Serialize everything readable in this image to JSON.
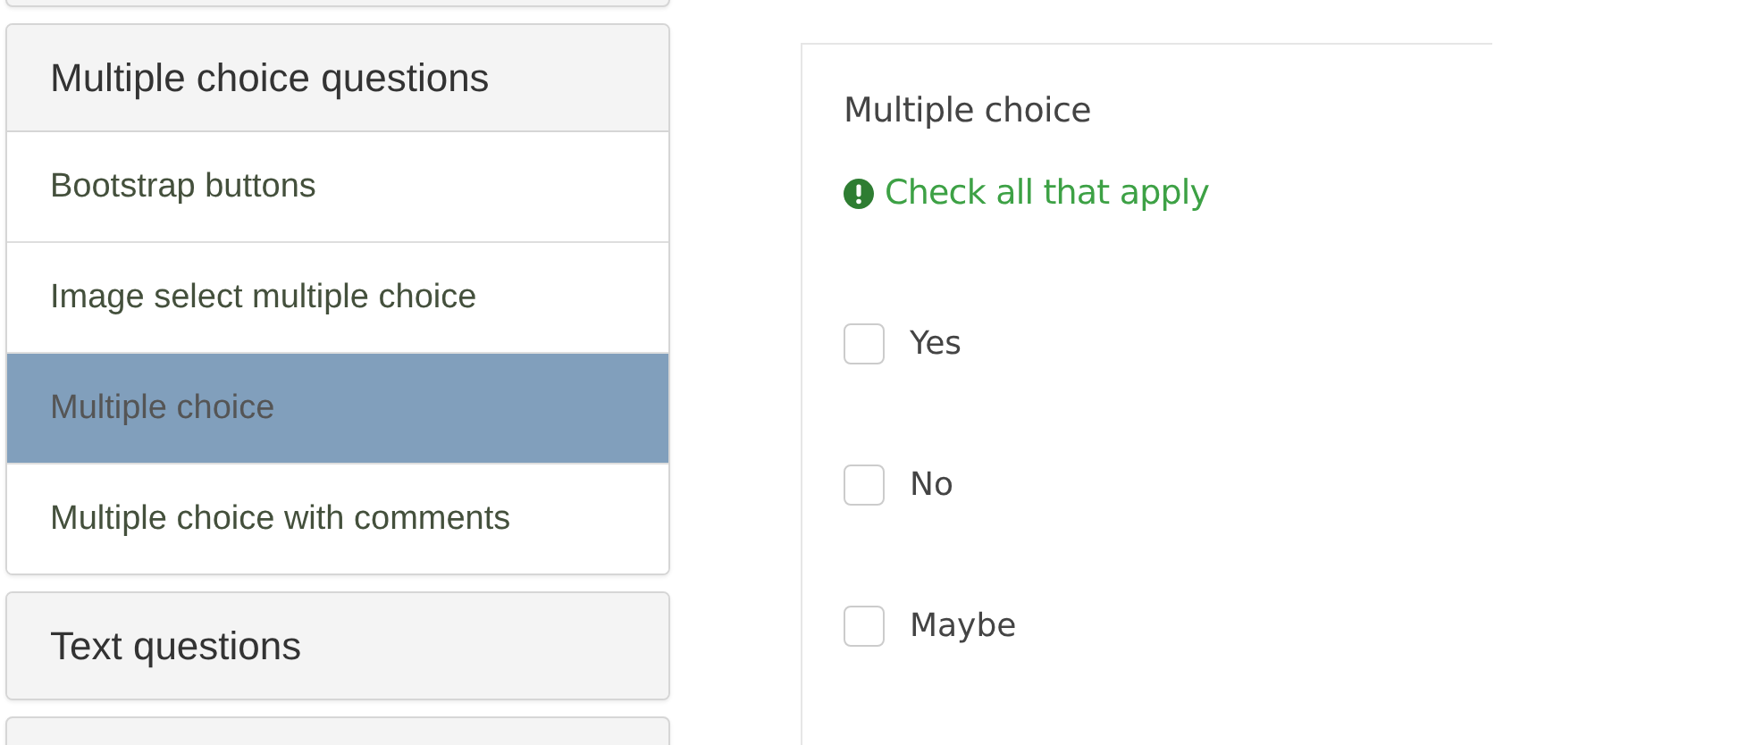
{
  "sidebar": {
    "groups": [
      {
        "title": "Multiple choice questions",
        "expanded": true,
        "items": [
          {
            "label": "Bootstrap buttons",
            "selected": false
          },
          {
            "label": "Image select multiple choice",
            "selected": false
          },
          {
            "label": "Multiple choice",
            "selected": true
          },
          {
            "label": "Multiple choice with comments",
            "selected": false
          }
        ]
      },
      {
        "title": "Text questions",
        "expanded": false
      }
    ]
  },
  "question": {
    "title": "Multiple choice",
    "hint": "Check all that apply",
    "options": [
      {
        "label": "Yes",
        "checked": false
      },
      {
        "label": "No",
        "checked": false
      },
      {
        "label": "Maybe",
        "checked": false
      }
    ]
  }
}
